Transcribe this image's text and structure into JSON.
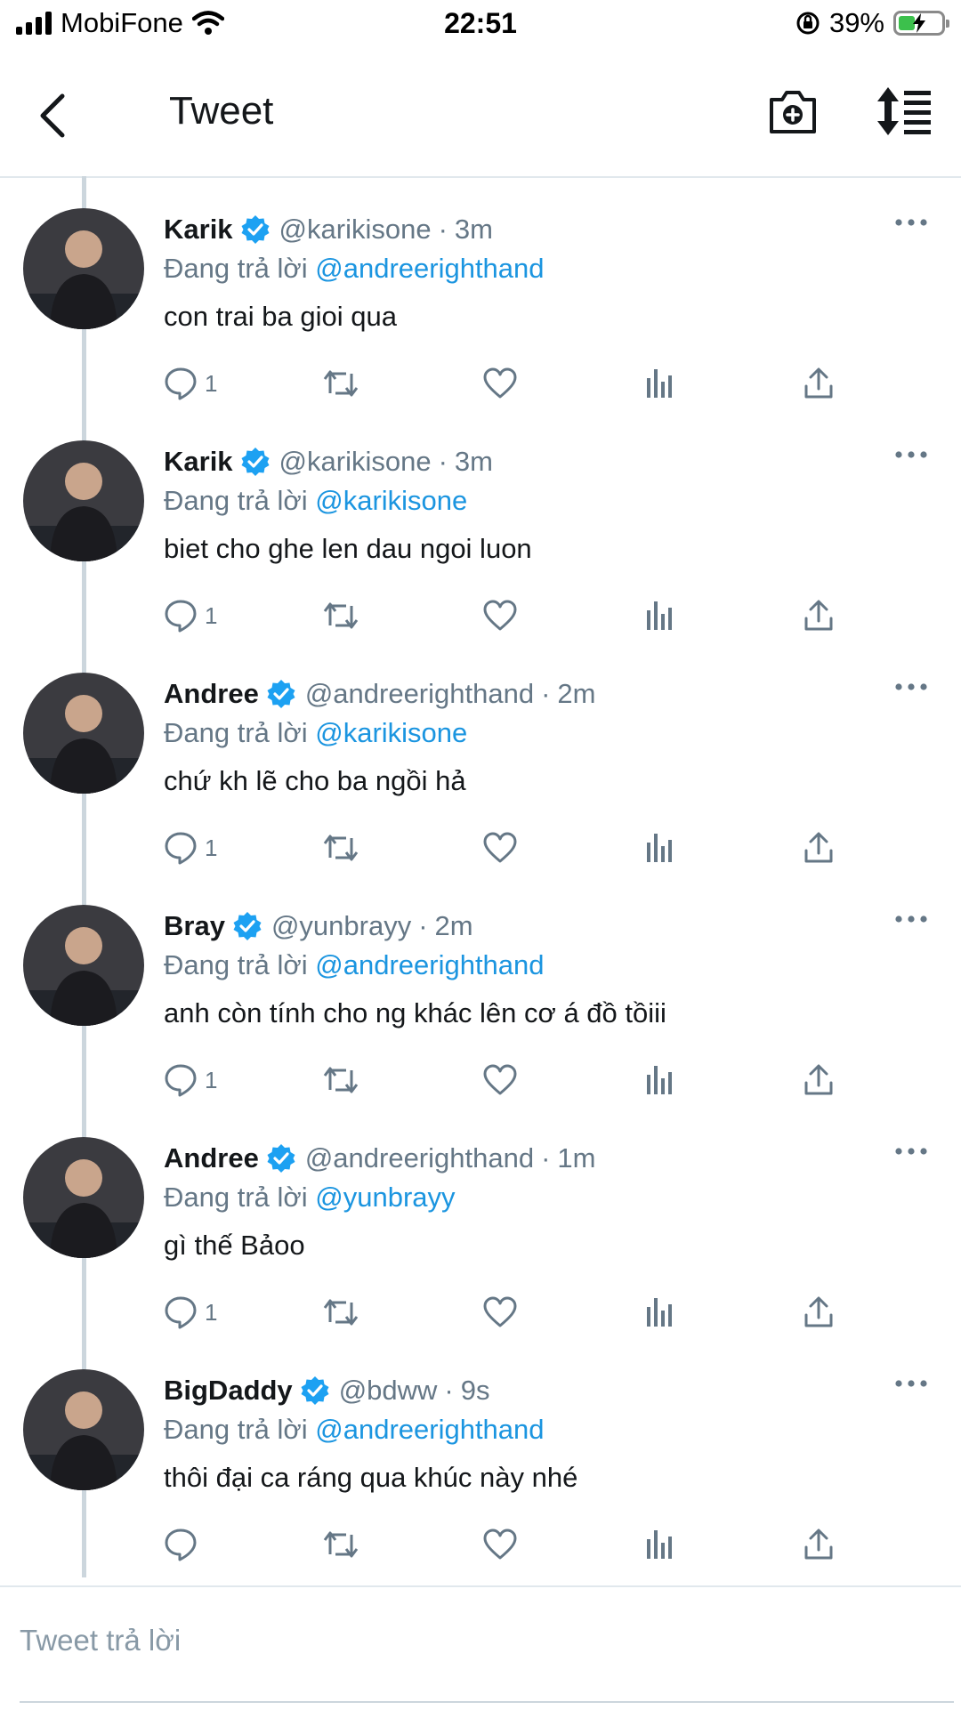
{
  "status_bar": {
    "carrier": "MobiFone",
    "time": "22:51",
    "battery": "39%",
    "battery_level": 0.39
  },
  "header": {
    "title": "Tweet",
    "back_icon": "chevron-left-icon",
    "camera_icon": "camera-plus-icon",
    "sort_icon": "sort-icon"
  },
  "colors": {
    "accent": "#1da1f2",
    "mention": "#1b95e0",
    "secondary_text": "#657786",
    "thread_line": "#ccd6dd"
  },
  "tweets": [
    {
      "name": "Karik",
      "handle": "@karikisone",
      "time": "3m",
      "reply_prefix": "Đang trả lời",
      "reply_to": "@andreerighthand",
      "text": "con trai ba gioi qua",
      "reply_count": "1"
    },
    {
      "name": "Karik",
      "handle": "@karikisone",
      "time": "3m",
      "reply_prefix": "Đang trả lời",
      "reply_to": "@karikisone",
      "text": "biet cho ghe len dau ngoi luon",
      "reply_count": "1"
    },
    {
      "name": "Andree",
      "handle": "@andreerighthand",
      "time": "2m",
      "reply_prefix": "Đang trả lời",
      "reply_to": "@karikisone",
      "text": "chứ kh lẽ cho ba ngồi hả",
      "reply_count": "1"
    },
    {
      "name": "Bray",
      "handle": "@yunbrayy",
      "time": "2m",
      "reply_prefix": "Đang trả lời",
      "reply_to": "@andreerighthand",
      "text": "anh còn tính cho ng khác lên cơ á đồ tồiii",
      "reply_count": "1"
    },
    {
      "name": "Andree",
      "handle": "@andreerighthand",
      "time": "1m",
      "reply_prefix": "Đang trả lời",
      "reply_to": "@yunbrayy",
      "text": "gì thế Bảoo",
      "reply_count": "1"
    },
    {
      "name": "BigDaddy",
      "handle": "@bdww",
      "time": "9s",
      "reply_prefix": "Đang trả lời",
      "reply_to": "@andreerighthand",
      "text": "thôi đại ca ráng qua khúc này nhé",
      "reply_count": ""
    }
  ],
  "composer": {
    "placeholder": "Tweet trả lời"
  }
}
